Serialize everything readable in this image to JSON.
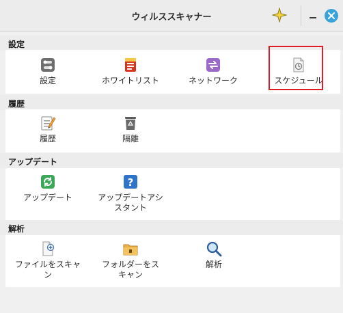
{
  "window": {
    "title": "ウィルススキャナー"
  },
  "sections": {
    "settings": {
      "header": "設定",
      "items": [
        {
          "label": "設定",
          "icon": "settings-toggle-icon"
        },
        {
          "label": "ホワイトリスト",
          "icon": "whitelist-icon"
        },
        {
          "label": "ネットワーク",
          "icon": "network-icon"
        },
        {
          "label": "スケジュール",
          "icon": "schedule-icon"
        }
      ]
    },
    "history": {
      "header": "履歴",
      "items": [
        {
          "label": "履歴",
          "icon": "history-notepad-icon"
        },
        {
          "label": "隔離",
          "icon": "quarantine-trash-icon"
        }
      ]
    },
    "update": {
      "header": "アップデート",
      "items": [
        {
          "label": "アップデート",
          "icon": "update-refresh-icon"
        },
        {
          "label": "アップデートアシ\nスタント",
          "icon": "update-assistant-help-icon"
        }
      ]
    },
    "analysis": {
      "header": "解析",
      "items": [
        {
          "label": "ファイルをスキャ\nン",
          "icon": "scan-file-icon"
        },
        {
          "label": "フォルダーをス\nキャン",
          "icon": "scan-folder-icon"
        },
        {
          "label": "解析",
          "icon": "analysis-magnifier-icon"
        }
      ]
    }
  },
  "colors": {
    "highlight": "#e01b24",
    "close_button": "#3ba3d8",
    "star": "#f5d33b"
  }
}
